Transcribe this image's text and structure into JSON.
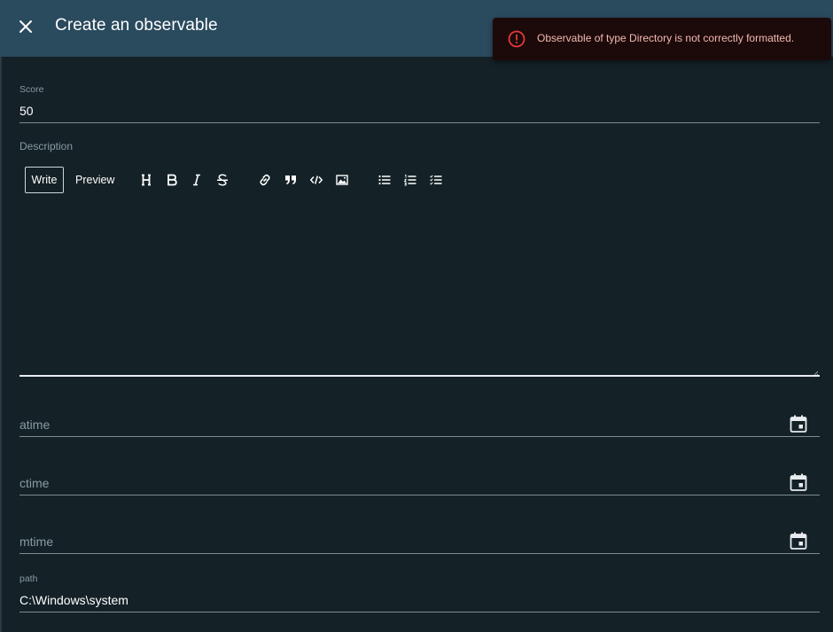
{
  "dialog": {
    "title": "Create an observable",
    "close_icon": "close-icon"
  },
  "toast": {
    "icon": "error-circle-icon",
    "message": "Observable of type Directory is not correctly formatted.",
    "color": "#f4b8b0"
  },
  "form": {
    "score": {
      "label": "Score",
      "value": "50"
    },
    "description": {
      "label": "Description",
      "tabs": {
        "write": "Write",
        "preview": "Preview"
      },
      "toolbar": [
        "heading-icon",
        "bold-icon",
        "italic-icon",
        "strikethrough-icon",
        "link-icon",
        "quote-icon",
        "code-icon",
        "image-icon",
        "unordered-list-icon",
        "ordered-list-icon",
        "checklist-icon"
      ],
      "value": ""
    },
    "atime": {
      "placeholder": "atime",
      "icon": "calendar-icon"
    },
    "ctime": {
      "placeholder": "ctime",
      "icon": "calendar-icon"
    },
    "mtime": {
      "placeholder": "mtime",
      "icon": "calendar-icon"
    },
    "path": {
      "label": "path",
      "value": "C:\\Windows\\system"
    }
  },
  "colors": {
    "header_bg": "#2a4a5e",
    "page_bg": "#142127",
    "toast_bg": "#1c0a0a",
    "error": "#e53935"
  }
}
